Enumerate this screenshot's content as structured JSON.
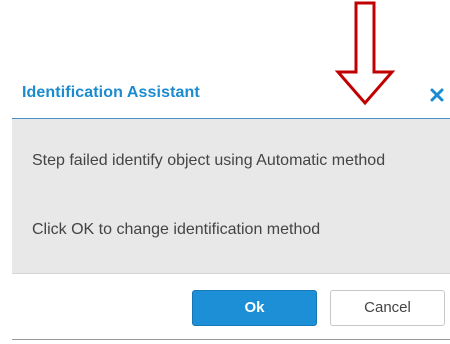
{
  "dialog": {
    "title": "Identification Assistant",
    "close_icon": "close-icon",
    "message_line1": "Step failed identify object using Automatic method",
    "message_line2": "Click OK to change identification method",
    "ok_label": "Ok",
    "cancel_label": "Cancel"
  },
  "annotation": {
    "arrow_icon": "down-arrow-icon",
    "arrow_color": "#c00000"
  },
  "colors": {
    "title": "#1b8bd0",
    "ok_button": "#1c8fd6",
    "panel": "#e8e8e8"
  }
}
